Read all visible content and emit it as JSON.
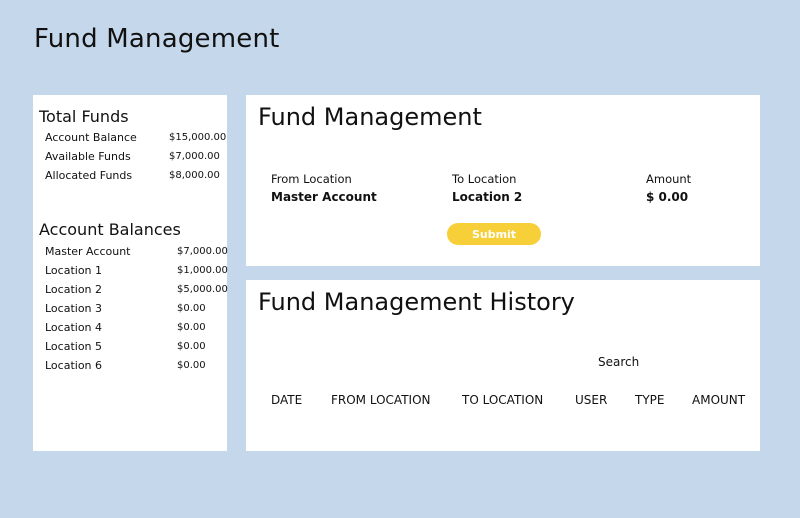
{
  "page": {
    "title": "Fund Management"
  },
  "summary": {
    "total_funds_heading": "Total Funds",
    "items": [
      {
        "label": "Account Balance",
        "value": "$15,000.00"
      },
      {
        "label": "Available Funds",
        "value": "$7,000.00"
      },
      {
        "label": "Allocated Funds",
        "value": "$8,000.00"
      }
    ],
    "account_balances_heading": "Account Balances",
    "balances": [
      {
        "label": "Master Account",
        "value": "$7,000.00"
      },
      {
        "label": "Location 1",
        "value": "$1,000.00"
      },
      {
        "label": "Location 2",
        "value": "$5,000.00"
      },
      {
        "label": "Location 3",
        "value": "$0.00"
      },
      {
        "label": "Location 4",
        "value": "$0.00"
      },
      {
        "label": "Location 5",
        "value": "$0.00"
      },
      {
        "label": "Location 6",
        "value": "$0.00"
      }
    ]
  },
  "transfer": {
    "title": "Fund Management",
    "from_label": "From Location",
    "from_value": "Master Account",
    "to_label": "To Location",
    "to_value": "Location 2",
    "amount_label": "Amount",
    "amount_value": "$ 0.00",
    "submit_label": "Submit",
    "submit_color": "#f7cf38"
  },
  "history": {
    "title": "Fund Management History",
    "search_label": "Search",
    "columns": [
      "DATE",
      "FROM LOCATION",
      "TO LOCATION",
      "USER",
      "TYPE",
      "AMOUNT"
    ]
  }
}
